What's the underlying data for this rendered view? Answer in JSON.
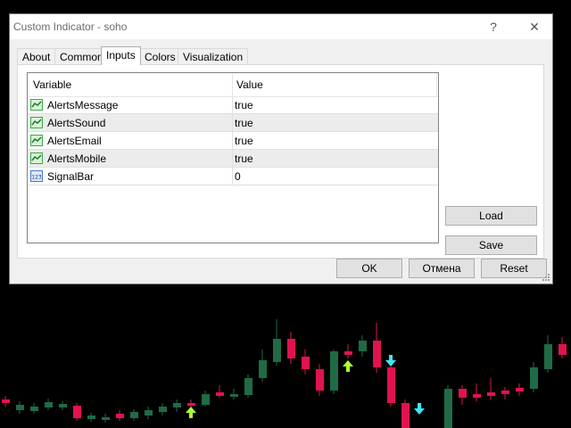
{
  "window": {
    "title": "Custom Indicator - soho",
    "help_label": "?",
    "close_label": "✕"
  },
  "tabs": [
    {
      "label": "About",
      "active": false
    },
    {
      "label": "Common",
      "active": false
    },
    {
      "label": "Inputs",
      "active": true
    },
    {
      "label": "Colors",
      "active": false
    },
    {
      "label": "Visualization",
      "active": false
    }
  ],
  "inputs": {
    "columns": [
      "Variable",
      "Value"
    ],
    "rows": [
      {
        "variable": "AlertsMessage",
        "value": "true",
        "icon": "bool-icon"
      },
      {
        "variable": "AlertsSound",
        "value": "true",
        "icon": "bool-icon"
      },
      {
        "variable": "AlertsEmail",
        "value": "true",
        "icon": "bool-icon"
      },
      {
        "variable": "AlertsMobile",
        "value": "true",
        "icon": "bool-icon"
      },
      {
        "variable": "SignalBar",
        "value": "0",
        "icon": "integer-icon"
      }
    ]
  },
  "side_buttons": {
    "load": "Load",
    "save": "Save"
  },
  "footer_buttons": {
    "ok": "OK",
    "cancel": "Отмена",
    "reset": "Reset"
  },
  "colors": {
    "bull_candle": "#1f6b46",
    "bear_candle": "#e0134f",
    "up_arrow": "#adff2f",
    "down_arrow": "#3ee6f0",
    "dialog_bg": "#f0f0f0"
  }
}
